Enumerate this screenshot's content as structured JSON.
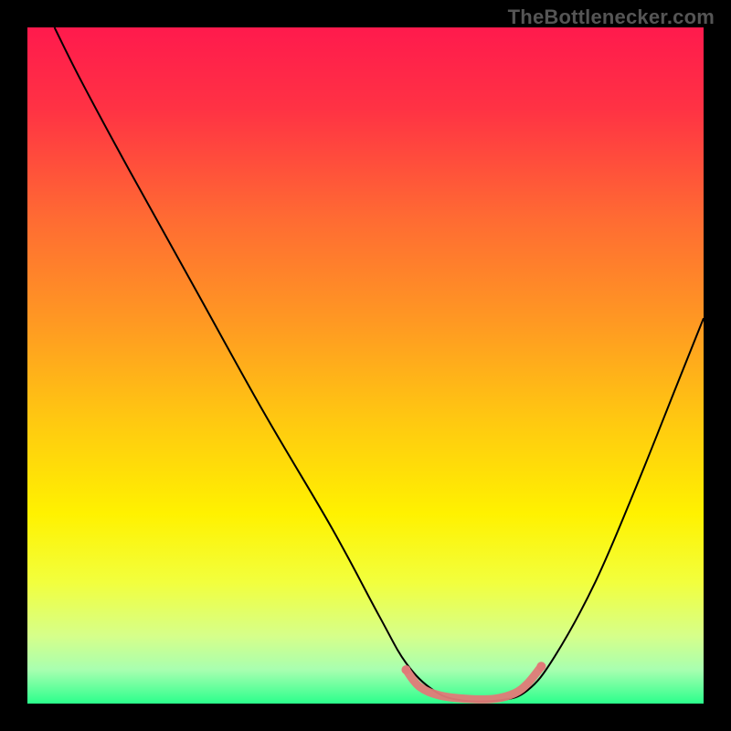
{
  "attribution": "TheBottlenecker.com",
  "chart_data": {
    "type": "line",
    "title": "",
    "xlabel": "",
    "ylabel": "",
    "xlim": [
      0,
      100
    ],
    "ylim": [
      0,
      100
    ],
    "background_gradient": {
      "stops": [
        {
          "offset": 0.0,
          "color": "#ff1a4d"
        },
        {
          "offset": 0.12,
          "color": "#ff3244"
        },
        {
          "offset": 0.28,
          "color": "#ff6a33"
        },
        {
          "offset": 0.44,
          "color": "#ff9a22"
        },
        {
          "offset": 0.58,
          "color": "#ffc811"
        },
        {
          "offset": 0.72,
          "color": "#fff200"
        },
        {
          "offset": 0.82,
          "color": "#f2ff3d"
        },
        {
          "offset": 0.9,
          "color": "#d6ff8a"
        },
        {
          "offset": 0.95,
          "color": "#a8ffb0"
        },
        {
          "offset": 1.0,
          "color": "#2bff8c"
        }
      ]
    },
    "series": [
      {
        "name": "bottleneck-curve",
        "color": "#000000",
        "width": 2,
        "points": [
          {
            "x": 4.0,
            "y": 100.0
          },
          {
            "x": 8.0,
            "y": 92.0
          },
          {
            "x": 15.0,
            "y": 79.0
          },
          {
            "x": 25.0,
            "y": 61.0
          },
          {
            "x": 35.0,
            "y": 43.0
          },
          {
            "x": 45.0,
            "y": 26.0
          },
          {
            "x": 52.0,
            "y": 13.0
          },
          {
            "x": 56.0,
            "y": 6.0
          },
          {
            "x": 60.0,
            "y": 2.0
          },
          {
            "x": 64.0,
            "y": 0.5
          },
          {
            "x": 70.0,
            "y": 0.5
          },
          {
            "x": 74.0,
            "y": 2.0
          },
          {
            "x": 78.0,
            "y": 7.0
          },
          {
            "x": 84.0,
            "y": 18.0
          },
          {
            "x": 90.0,
            "y": 32.0
          },
          {
            "x": 96.0,
            "y": 47.0
          },
          {
            "x": 100.0,
            "y": 57.0
          }
        ]
      },
      {
        "name": "highlight-range",
        "color": "#e07a78",
        "width": 9,
        "linecap": "round",
        "points": [
          {
            "x": 56.0,
            "y": 5.0
          },
          {
            "x": 58.0,
            "y": 2.5
          },
          {
            "x": 61.0,
            "y": 1.2
          },
          {
            "x": 65.0,
            "y": 0.7
          },
          {
            "x": 69.0,
            "y": 0.7
          },
          {
            "x": 72.0,
            "y": 1.5
          },
          {
            "x": 74.0,
            "y": 3.0
          },
          {
            "x": 76.0,
            "y": 5.5
          }
        ]
      }
    ],
    "markers": [
      {
        "x": 56.0,
        "y": 5.0,
        "r": 5,
        "color": "#e07a78"
      },
      {
        "x": 76.0,
        "y": 5.5,
        "r": 5,
        "color": "#e07a78"
      }
    ]
  }
}
